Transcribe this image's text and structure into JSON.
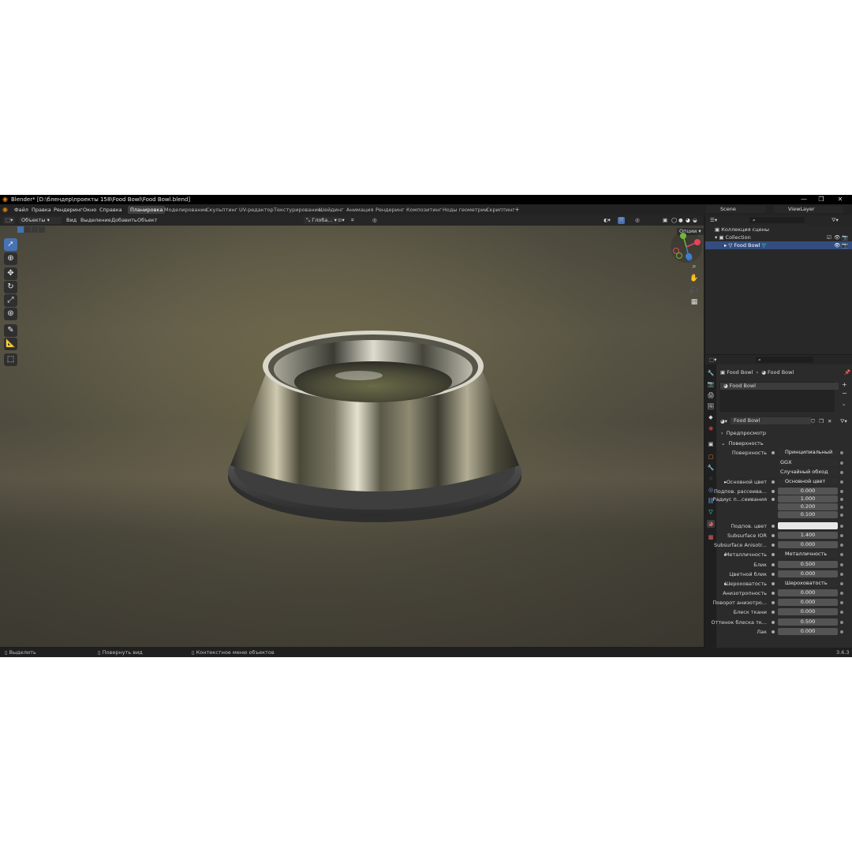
{
  "titlebar": {
    "title": "Blender* [D:\\блендер\\проекты 158\\Food Bowl\\Food Bowl.blend]"
  },
  "menu": {
    "items": [
      "Файл",
      "Правка",
      "Рендеринг",
      "Окно",
      "Справка"
    ]
  },
  "workspaces": [
    "Планировка",
    "Моделирование",
    "Скульптинг",
    "UV-редактор",
    "Текстурирование",
    "Шейдинг",
    "Анимация",
    "Рендеринг",
    "Композитинг",
    "Ноды геометрии",
    "Скриптинг"
  ],
  "scene": {
    "scene_name": "Scene",
    "view_layer": "ViewLayer"
  },
  "viewport_header": {
    "mode": "Объекты",
    "view": "Вид",
    "select": "Выделение",
    "add": "Добавить",
    "object": "Объект",
    "transform": "Глоба...",
    "options": "Опции"
  },
  "outliner": {
    "root": "Коллекция сцены",
    "collection": "Collection",
    "object": "Food Bowl"
  },
  "properties": {
    "breadcrumb_object": "Food Bowl",
    "breadcrumb_material": "Food Bowl",
    "slot_name": "Food Bowl",
    "material_name": "Food Bowl",
    "preview": "Предпросмотр",
    "surface_section": "Поверхность",
    "rows": [
      {
        "label": "Поверхность",
        "value": "Принципиальный BSDF",
        "kind": "link"
      },
      {
        "label": "",
        "value": "GGX",
        "kind": "drop"
      },
      {
        "label": "",
        "value": "Случайный обход",
        "kind": "drop"
      },
      {
        "label": "Основной цвет",
        "value": "Основной цвет",
        "kind": "link"
      },
      {
        "label": "Подпов. рассеива...",
        "value": "0.000",
        "kind": "num",
        "fill": 0
      },
      {
        "label": "Радиус п...сеивания",
        "value": "1.000",
        "kind": "num",
        "fill": 0
      },
      {
        "label": "",
        "value": "0.200",
        "kind": "num",
        "fill": 0
      },
      {
        "label": "",
        "value": "0.100",
        "kind": "num",
        "fill": 0
      },
      {
        "label": "Подпов. цвет",
        "value": "",
        "kind": "color"
      },
      {
        "label": "Subsurface IOR",
        "value": "1.400",
        "kind": "num",
        "fill": 0.12
      },
      {
        "label": "Subsurface Anisotr...",
        "value": "0.000",
        "kind": "num",
        "fill": 0
      },
      {
        "label": "Металличность",
        "value": "Металличность",
        "kind": "link"
      },
      {
        "label": "Блик",
        "value": "0.500",
        "kind": "num",
        "fill": 0.5
      },
      {
        "label": "Цветной блик",
        "value": "0.000",
        "kind": "num",
        "fill": 0
      },
      {
        "label": "Шероховатость",
        "value": "Шероховатость",
        "kind": "link"
      },
      {
        "label": "Анизотропность",
        "value": "0.000",
        "kind": "num",
        "fill": 0
      },
      {
        "label": "Поворот анизотро...",
        "value": "0.000",
        "kind": "num",
        "fill": 0
      },
      {
        "label": "Блеск ткани",
        "value": "0.000",
        "kind": "num",
        "fill": 0
      },
      {
        "label": "Оттенок блеска тк...",
        "value": "0.500",
        "kind": "num",
        "fill": 0.5
      },
      {
        "label": "Лак",
        "value": "0.000",
        "kind": "num",
        "fill": 0
      }
    ]
  },
  "statusbar": {
    "select": "Выделить",
    "rotate": "Повернуть вид",
    "context": "Контекстное меню объектов",
    "version": "3.6.3"
  },
  "colors": {
    "accent": "#4772b3",
    "selection": "#334d80",
    "bg": "#1d1d1d"
  }
}
